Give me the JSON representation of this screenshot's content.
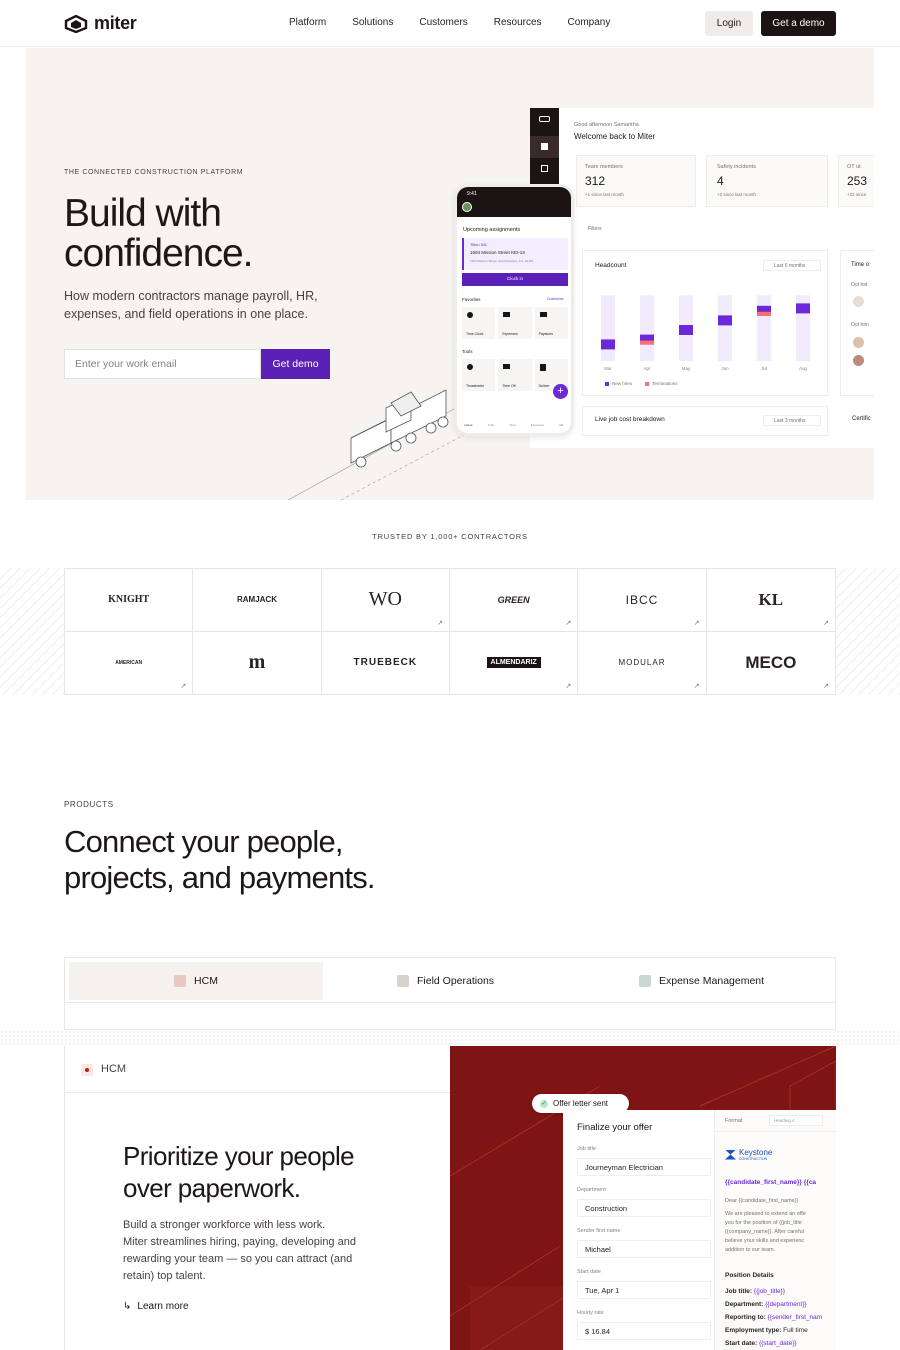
{
  "nav": {
    "brand": "miter",
    "links": [
      "Platform",
      "Solutions",
      "Customers",
      "Resources",
      "Company"
    ],
    "login": "Login",
    "demo": "Get a demo"
  },
  "hero": {
    "eyebrow": "THE CONNECTED CONSTRUCTION PLATFORM",
    "title_line1": "Build with",
    "title_line2": "confidence.",
    "subtitle_line1": "How modern contractors manage payroll, HR,",
    "subtitle_line2": "expenses, and field operations in one place.",
    "email_placeholder": "Enter your work email",
    "cta": "Get demo"
  },
  "dashboard": {
    "greeting": "Good afternoon Samantha",
    "welcome": "Welcome back to Miter",
    "stats": [
      {
        "label": "Team members",
        "value": "312",
        "note": "+1 since last month"
      },
      {
        "label": "Safety incidents",
        "value": "4",
        "note": "+2 since last month"
      },
      {
        "label": "OT ut",
        "value": "253",
        "note": "+22 since"
      }
    ],
    "filters": "Filters",
    "headcount": "Headcount",
    "range": "Last 6 months",
    "months": [
      "Mar",
      "Apr",
      "May",
      "Jun",
      "Jul",
      "Aug"
    ],
    "chart_series": {
      "new_hires": [
        0.27,
        0.33,
        0.45,
        0.57,
        0.69,
        0.72
      ],
      "terminations": [
        0,
        0.07,
        0,
        0,
        0.06,
        0
      ]
    },
    "legend_new": "New hires",
    "legend_term": "Terminations",
    "time_off": "Time o",
    "out_today": "Out tod",
    "out_tomorrow": "Out tom",
    "job_cost": "Live job cost breakdown",
    "range2": "Last 3 months",
    "cert": "Certific"
  },
  "phone": {
    "time": "9:41",
    "upcoming": "Upcoming assignments",
    "job_num": "Tilton IN1",
    "job_addr": "1604 Mission Street KEI-13",
    "job_city": "1604 Mission Street, San Francisco, CA, 94103",
    "clockin": "Clock in",
    "favorites": "Favorites",
    "customize": "Customize",
    "fav_items": [
      "Time Clock",
      "Expenses",
      "Paystubs"
    ],
    "tools": "Tools",
    "tool_items": [
      "Timesheets",
      "Time Off",
      "Deliver"
    ],
    "bottom_items": [
      "Home",
      "Jobs",
      "Time",
      "Expenses",
      "HR"
    ]
  },
  "trusted": {
    "label": "TRUSTED BY 1,000+ CONTRACTORS",
    "logos": [
      "KNIGHT",
      "RAMJACK",
      "WO",
      "GREEN",
      "IBCC",
      "KL",
      "AMERICAN",
      "m",
      "TRUEBECK",
      "ALMENDARIZ",
      "MODULAR",
      "MECO"
    ]
  },
  "products": {
    "eyebrow": "PRODUCTS",
    "title_line1": "Connect your people,",
    "title_line2": "projects, and payments.",
    "tabs": [
      "HCM",
      "Field Operations",
      "Expense Management"
    ],
    "hcm_label": "HCM",
    "headline_line1": "Prioritize your people",
    "headline_line2": "over paperwork.",
    "body_line1": "Build a stronger workforce with less work.",
    "body_line2": "Miter streamlines hiring, paying, developing and",
    "body_line3": "rewarding your team — so you can attract (and",
    "body_line4": "retain) top talent.",
    "learn_more": "Learn more"
  },
  "offer": {
    "badge": "Offer letter sent",
    "title": "Finalize your offer",
    "fields": [
      {
        "label": "Job title",
        "value": "Journeyman Electrician"
      },
      {
        "label": "Department",
        "value": "Construction"
      },
      {
        "label": "Sender first name",
        "value": "Michael"
      },
      {
        "label": "Start date",
        "value": "Tue, Apr 1"
      },
      {
        "label": "Hourly rate",
        "value": "$  16.84"
      }
    ],
    "format": "Format",
    "heading": "Heading 4",
    "company": "Keystone",
    "company_sub": "CONSTRUCTION",
    "greeting_tokens": "{{candidate_first_name}}  {{ca",
    "dear": "Dear {{candidate_first_name}}",
    "letter": [
      "We are pleased to extend an offe",
      "you for the position of {{job_title",
      "{{company_name}}. After careful",
      "believe your skills and experienc",
      "addition to our team."
    ],
    "details": "Position Details",
    "detail_rows": [
      {
        "k": "Job title:",
        "v": "{{job_title}}"
      },
      {
        "k": "Department:",
        "v": "{{department}}"
      },
      {
        "k": "Reporting to:",
        "v": "{{sender_first_nam"
      },
      {
        "k": "Employment type:",
        "v": "Full time"
      },
      {
        "k": "Start date:",
        "v": "{{start_date}}"
      }
    ]
  },
  "colors": {
    "accent": "#5b21b6",
    "dark": "#1c1414",
    "hero_bg": "#f6f3f1",
    "offer_bg": "#7f1414"
  }
}
